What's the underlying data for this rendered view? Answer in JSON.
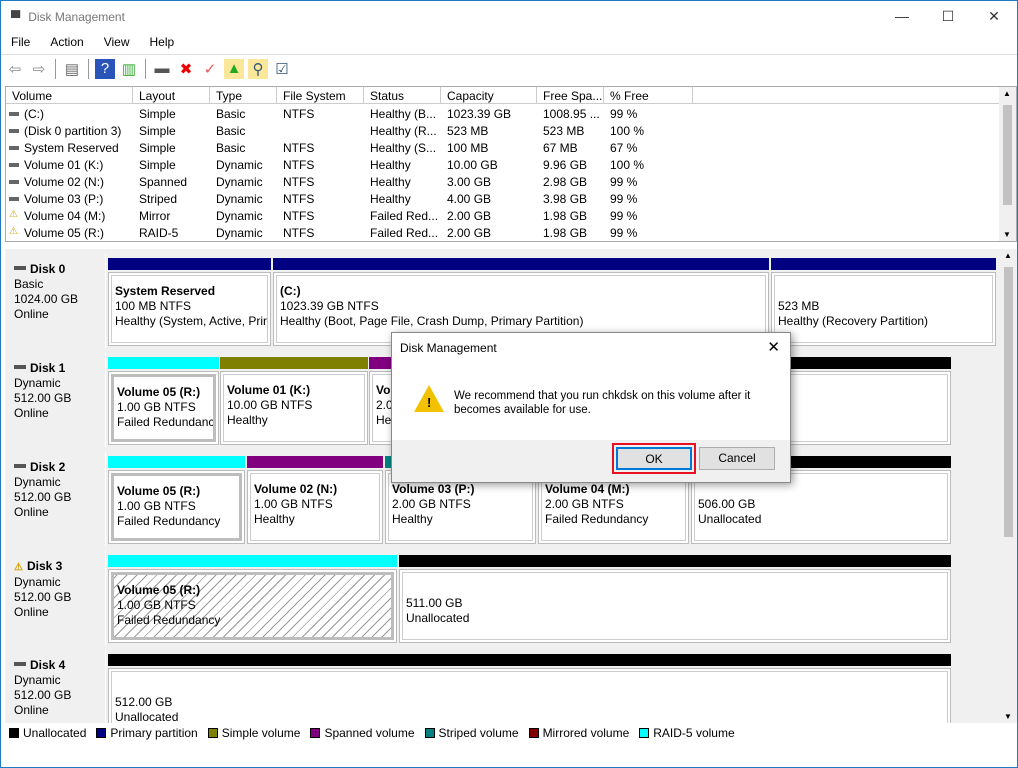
{
  "window": {
    "title": "Disk Management",
    "minimize": "—",
    "maximize": "☐",
    "close": "✕"
  },
  "menu": [
    "File",
    "Action",
    "View",
    "Help"
  ],
  "toolbar": [
    {
      "icon": "back-arrow-icon",
      "glyph": "⇦",
      "color": "#888"
    },
    {
      "icon": "forward-arrow-icon",
      "glyph": "⇨",
      "color": "#888"
    },
    {
      "sep": true
    },
    {
      "icon": "show-hide-console-tree-icon",
      "glyph": "▤",
      "color": "#666"
    },
    {
      "sep": true
    },
    {
      "icon": "help-icon",
      "glyph": "?",
      "color": "#fff",
      "bg": "#2a55b8"
    },
    {
      "icon": "show-hide-action-pane-icon",
      "glyph": "▥",
      "color": "#3a3"
    },
    {
      "sep": true
    },
    {
      "icon": "connect-disk-icon",
      "glyph": "▬",
      "color": "#555"
    },
    {
      "icon": "delete-icon",
      "glyph": "✖",
      "color": "#e00"
    },
    {
      "icon": "properties-check-icon",
      "glyph": "✓",
      "color": "#e55"
    },
    {
      "icon": "folder-up-icon",
      "glyph": "▲",
      "color": "#2a2",
      "bg": "#fbe79a"
    },
    {
      "icon": "folder-search-icon",
      "glyph": "⚲",
      "color": "#357",
      "bg": "#fbe79a"
    },
    {
      "icon": "checklist-icon",
      "glyph": "☑",
      "color": "#357"
    }
  ],
  "volumes": {
    "columns": [
      "Volume",
      "Layout",
      "Type",
      "File System",
      "Status",
      "Capacity",
      "Free Spa...",
      "% Free"
    ],
    "rows": [
      {
        "warn": false,
        "cells": [
          "(C:)",
          "Simple",
          "Basic",
          "NTFS",
          "Healthy (B...",
          "1023.39 GB",
          "1008.95 ...",
          "99 %"
        ]
      },
      {
        "warn": false,
        "cells": [
          "(Disk 0 partition 3)",
          "Simple",
          "Basic",
          "",
          "Healthy (R...",
          "523 MB",
          "523 MB",
          "100 %"
        ]
      },
      {
        "warn": false,
        "cells": [
          "System Reserved",
          "Simple",
          "Basic",
          "NTFS",
          "Healthy (S...",
          "100 MB",
          "67 MB",
          "67 %"
        ]
      },
      {
        "warn": false,
        "cells": [
          "Volume 01 (K:)",
          "Simple",
          "Dynamic",
          "NTFS",
          "Healthy",
          "10.00 GB",
          "9.96 GB",
          "100 %"
        ]
      },
      {
        "warn": false,
        "cells": [
          "Volume 02 (N:)",
          "Spanned",
          "Dynamic",
          "NTFS",
          "Healthy",
          "3.00 GB",
          "2.98 GB",
          "99 %"
        ]
      },
      {
        "warn": false,
        "cells": [
          "Volume 03 (P:)",
          "Striped",
          "Dynamic",
          "NTFS",
          "Healthy",
          "4.00 GB",
          "3.98 GB",
          "99 %"
        ]
      },
      {
        "warn": true,
        "cells": [
          "Volume 04 (M:)",
          "Mirror",
          "Dynamic",
          "NTFS",
          "Failed Red...",
          "2.00 GB",
          "1.98 GB",
          "99 %"
        ]
      },
      {
        "warn": true,
        "cells": [
          "Volume 05 (R:)",
          "RAID-5",
          "Dynamic",
          "NTFS",
          "Failed Red...",
          "2.00 GB",
          "1.98 GB",
          "99 %"
        ]
      }
    ]
  },
  "colors": {
    "unallocated": "#000000",
    "primary": "#000080",
    "simple": "#808000",
    "spanned": "#800080",
    "striped": "#008080",
    "mirrored": "#800000",
    "raid5": "#00ffff"
  },
  "disks": [
    {
      "name": "Disk 0",
      "warn": false,
      "type": "Basic",
      "size": "1024.00 GB",
      "status": "Online",
      "parts": [
        {
          "kind": "primary",
          "title": "System Reserved",
          "l1": "100 MB NTFS",
          "l2": "Healthy (System, Active, Prir"
        },
        {
          "kind": "primary",
          "title": "(C:)",
          "l1": "1023.39 GB NTFS",
          "l2": "Healthy (Boot, Page File, Crash Dump, Primary Partition)"
        },
        {
          "kind": "primary",
          "title": "",
          "l1": "523 MB",
          "l2": "Healthy (Recovery Partition)"
        }
      ]
    },
    {
      "name": "Disk 1",
      "warn": false,
      "type": "Dynamic",
      "size": "512.00 GB",
      "status": "Online",
      "parts": [
        {
          "kind": "raid5",
          "title": "Volume 05  (R:)",
          "l1": "1.00 GB NTFS",
          "l2": "Failed Redundancy",
          "selected": true
        },
        {
          "kind": "simple",
          "title": "Volume 01  (K:)",
          "l1": "10.00 GB NTFS",
          "l2": "Healthy"
        },
        {
          "kind": "spanned",
          "title": "Vo",
          "l1": "2.0",
          "l2": "He"
        },
        {
          "kind": "unallocated",
          "title": "",
          "l1": "B",
          "l2": "ted"
        }
      ]
    },
    {
      "name": "Disk 2",
      "warn": false,
      "type": "Dynamic",
      "size": "512.00 GB",
      "status": "Online",
      "parts": [
        {
          "kind": "raid5",
          "title": "Volume 05  (R:)",
          "l1": "1.00 GB NTFS",
          "l2": "Failed Redundancy",
          "selected": true
        },
        {
          "kind": "spanned",
          "title": "Volume 02  (N:)",
          "l1": "1.00 GB NTFS",
          "l2": "Healthy"
        },
        {
          "kind": "striped",
          "title": "Volume 03  (P:)",
          "l1": "2.00 GB NTFS",
          "l2": "Healthy"
        },
        {
          "kind": "mirrored",
          "title": "Volume 04  (M:)",
          "l1": "2.00 GB NTFS",
          "l2": "Failed Redundancy"
        },
        {
          "kind": "unallocated",
          "title": "",
          "l1": "506.00 GB",
          "l2": "Unallocated"
        }
      ]
    },
    {
      "name": "Disk 3",
      "warn": true,
      "type": "Dynamic",
      "size": "512.00 GB",
      "status": "Online",
      "parts": [
        {
          "kind": "raid5",
          "title": "Volume 05  (R:)",
          "l1": "1.00 GB NTFS",
          "l2": "Failed Redundancy",
          "selected": true,
          "hatched": true
        },
        {
          "kind": "unallocated",
          "title": "",
          "l1": "511.00 GB",
          "l2": "Unallocated"
        }
      ]
    },
    {
      "name": "Disk 4",
      "warn": false,
      "type": "Dynamic",
      "size": "512.00 GB",
      "status": "Online",
      "parts": [
        {
          "kind": "unallocated",
          "title": "",
          "l1": "512.00 GB",
          "l2": "Unallocated"
        }
      ]
    }
  ],
  "legend": [
    {
      "kind": "unallocated",
      "label": "Unallocated"
    },
    {
      "kind": "primary",
      "label": "Primary partition"
    },
    {
      "kind": "simple",
      "label": "Simple volume"
    },
    {
      "kind": "spanned",
      "label": "Spanned volume"
    },
    {
      "kind": "striped",
      "label": "Striped volume"
    },
    {
      "kind": "mirrored",
      "label": "Mirrored volume"
    },
    {
      "kind": "raid5",
      "label": "RAID-5 volume"
    }
  ],
  "dialog": {
    "title": "Disk Management",
    "message": "We recommend that you run chkdsk on this volume after it becomes available for use.",
    "ok": "OK",
    "cancel": "Cancel",
    "close": "✕",
    "highlight": "#e81123"
  }
}
